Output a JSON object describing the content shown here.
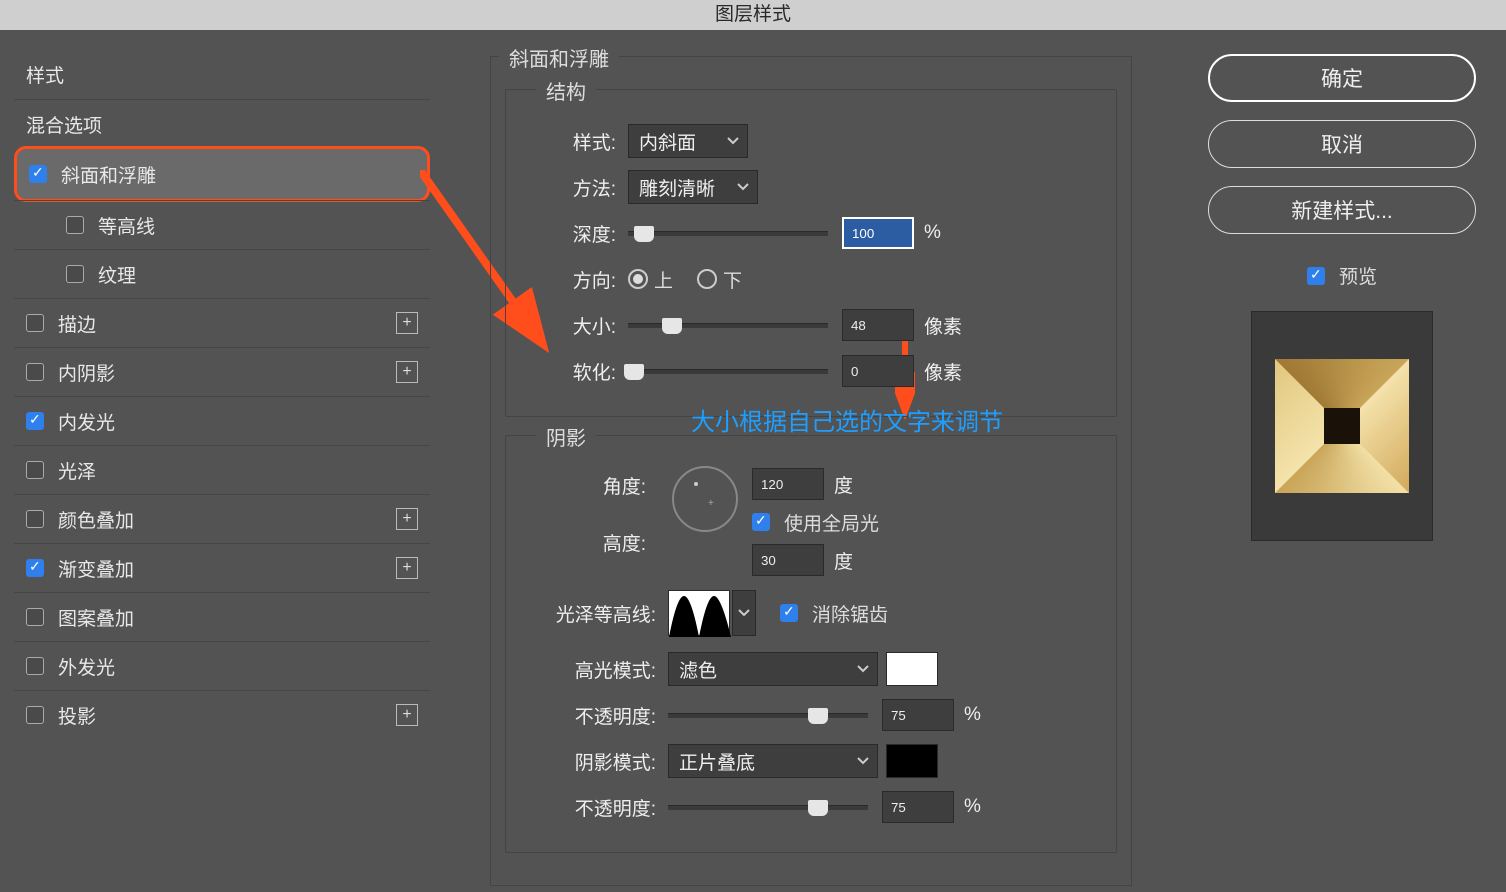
{
  "title": "图层样式",
  "sidebar": {
    "styles": "样式",
    "blending": "混合选项",
    "items": [
      {
        "label": "斜面和浮雕",
        "checked": true,
        "active": true,
        "highlighted": true,
        "plus": false
      },
      {
        "label": "等高线",
        "checked": false,
        "sub": true
      },
      {
        "label": "纹理",
        "checked": false,
        "sub": true
      },
      {
        "label": "描边",
        "checked": false,
        "plus": true
      },
      {
        "label": "内阴影",
        "checked": false,
        "plus": true
      },
      {
        "label": "内发光",
        "checked": true
      },
      {
        "label": "光泽",
        "checked": false
      },
      {
        "label": "颜色叠加",
        "checked": false,
        "plus": true
      },
      {
        "label": "渐变叠加",
        "checked": true,
        "plus": true
      },
      {
        "label": "图案叠加",
        "checked": false
      },
      {
        "label": "外发光",
        "checked": false
      },
      {
        "label": "投影",
        "checked": false,
        "plus": true
      }
    ]
  },
  "panel": {
    "title": "斜面和浮雕",
    "structure": {
      "title": "结构",
      "style_label": "样式:",
      "style_value": "内斜面",
      "technique_label": "方法:",
      "technique_value": "雕刻清晰",
      "depth_label": "深度:",
      "depth_value": "100",
      "depth_unit": "%",
      "direction_label": "方向:",
      "direction_up": "上",
      "direction_down": "下",
      "size_label": "大小:",
      "size_value": "48",
      "size_unit": "像素",
      "soften_label": "软化:",
      "soften_value": "0",
      "soften_unit": "像素"
    },
    "shading": {
      "title": "阴影",
      "angle_label": "角度:",
      "angle_value": "120",
      "angle_unit": "度",
      "global_light": "使用全局光",
      "altitude_label": "高度:",
      "altitude_value": "30",
      "altitude_unit": "度",
      "contour_label": "光泽等高线:",
      "antialias": "消除锯齿",
      "highlight_mode_label": "高光模式:",
      "highlight_mode_value": "滤色",
      "highlight_opacity_label": "不透明度:",
      "highlight_opacity_value": "75",
      "highlight_opacity_unit": "%",
      "shadow_mode_label": "阴影模式:",
      "shadow_mode_value": "正片叠底",
      "shadow_opacity_label": "不透明度:",
      "shadow_opacity_value": "75",
      "shadow_opacity_unit": "%"
    }
  },
  "annotation": "大小根据自己选的文字来调节",
  "buttons": {
    "ok": "确定",
    "cancel": "取消",
    "new_style": "新建样式...",
    "preview": "预览"
  },
  "colors": {
    "highlight_swatch": "#ffffff",
    "shadow_swatch": "#000000"
  }
}
